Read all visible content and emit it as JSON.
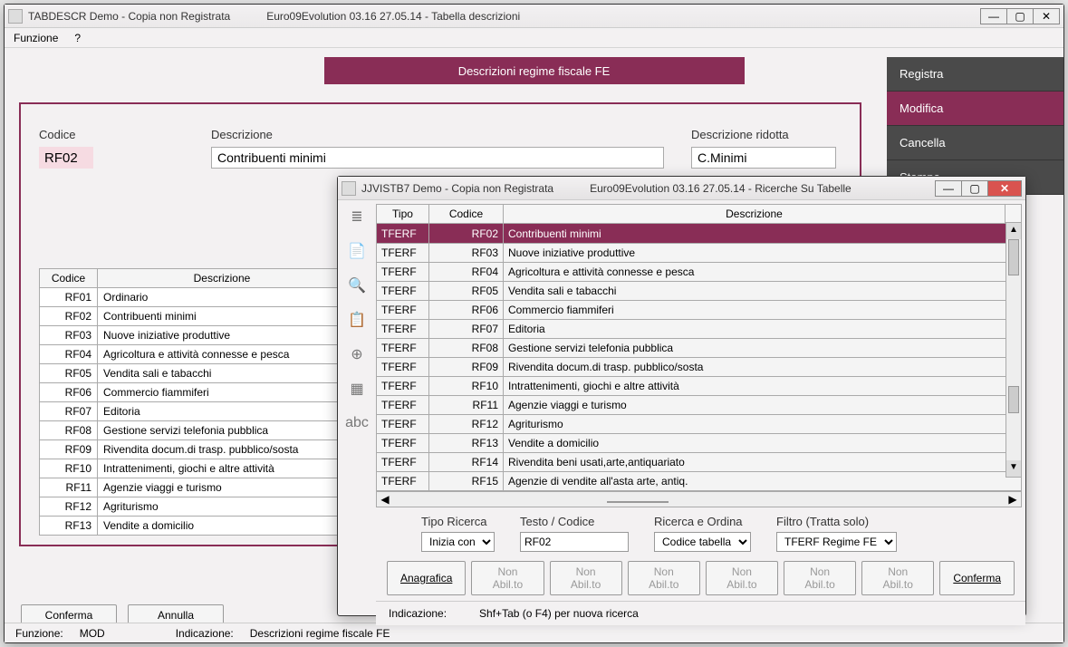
{
  "mainWin": {
    "titleA": "TABDESCR Demo - Copia non Registrata",
    "titleB": "Euro09Evolution 03.16 27.05.14 -  Tabella descrizioni",
    "menu": {
      "funzione": "Funzione",
      "help": "?"
    },
    "banner": "Descrizioni regime fiscale FE",
    "actions": {
      "registra": "Registra",
      "modifica": "Modifica",
      "cancella": "Cancella",
      "stampa": "Stampa"
    },
    "form": {
      "lbl_codice": "Codice",
      "val_codice": "RF02",
      "lbl_descr": "Descrizione",
      "val_descr": "Contribuenti minimi",
      "lbl_rid": "Descrizione ridotta",
      "val_rid": "C.Minimi"
    },
    "table": {
      "h1": "Codice",
      "h2": "Descrizione",
      "rows": [
        {
          "c": "RF01",
          "d": "Ordinario"
        },
        {
          "c": "RF02",
          "d": "Contribuenti minimi"
        },
        {
          "c": "RF03",
          "d": "Nuove iniziative produttive"
        },
        {
          "c": "RF04",
          "d": "Agricoltura e attività connesse e pesca"
        },
        {
          "c": "RF05",
          "d": "Vendita sali e tabacchi"
        },
        {
          "c": "RF06",
          "d": "Commercio fiammiferi"
        },
        {
          "c": "RF07",
          "d": "Editoria"
        },
        {
          "c": "RF08",
          "d": "Gestione servizi telefonia pubblica"
        },
        {
          "c": "RF09",
          "d": "Rivendita docum.di trasp. pubblico/sosta"
        },
        {
          "c": "RF10",
          "d": "Intrattenimenti, giochi e altre attività"
        },
        {
          "c": "RF11",
          "d": "Agenzie viaggi e turismo"
        },
        {
          "c": "RF12",
          "d": "Agriturismo"
        },
        {
          "c": "RF13",
          "d": "Vendite a domicilio"
        }
      ]
    },
    "buttons": {
      "conferma": "Conferma",
      "annulla": "Annulla"
    },
    "status": {
      "funz_lbl": "Funzione:",
      "funz": "MOD",
      "ind_lbl": "Indicazione:",
      "ind": "Descrizioni regime fiscale FE"
    }
  },
  "lookupWin": {
    "titleA": "JJVISTB7 Demo - Copia non Registrata",
    "titleB": "Euro09Evolution 03.16 27.05.14 - Ricerche Su Tabelle",
    "icons": [
      "≣",
      "📄",
      "🔍",
      "📋",
      "⊕",
      "▦",
      "abc"
    ],
    "headers": {
      "tipo": "Tipo",
      "codice": "Codice",
      "descr": "Descrizione"
    },
    "rows": [
      {
        "t": "TFERF",
        "c": "RF02",
        "d": "Contribuenti minimi"
      },
      {
        "t": "TFERF",
        "c": "RF03",
        "d": "Nuove iniziative produttive"
      },
      {
        "t": "TFERF",
        "c": "RF04",
        "d": "Agricoltura e attività connesse e pesca"
      },
      {
        "t": "TFERF",
        "c": "RF05",
        "d": "Vendita sali e tabacchi"
      },
      {
        "t": "TFERF",
        "c": "RF06",
        "d": "Commercio fiammiferi"
      },
      {
        "t": "TFERF",
        "c": "RF07",
        "d": "Editoria"
      },
      {
        "t": "TFERF",
        "c": "RF08",
        "d": "Gestione servizi telefonia pubblica"
      },
      {
        "t": "TFERF",
        "c": "RF09",
        "d": "Rivendita docum.di trasp. pubblico/sosta"
      },
      {
        "t": "TFERF",
        "c": "RF10",
        "d": "Intrattenimenti, giochi e altre attività"
      },
      {
        "t": "TFERF",
        "c": "RF11",
        "d": "Agenzie viaggi e turismo"
      },
      {
        "t": "TFERF",
        "c": "RF12",
        "d": "Agriturismo"
      },
      {
        "t": "TFERF",
        "c": "RF13",
        "d": "Vendite a domicilio"
      },
      {
        "t": "TFERF",
        "c": "RF14",
        "d": "Rivendita beni usati,arte,antiquariato"
      },
      {
        "t": "TFERF",
        "c": "RF15",
        "d": "Agenzie di vendite all'asta arte, antiq."
      }
    ],
    "search": {
      "tipo_lbl": "Tipo Ricerca",
      "tipo": "Inizia con",
      "testo_lbl": "Testo / Codice",
      "testo": "RF02",
      "ord_lbl": "Ricerca e Ordina",
      "ord": "Codice tabella",
      "filtro_lbl": "Filtro (Tratta solo)",
      "filtro": "TFERF Regime FE"
    },
    "btns": {
      "anag": "Anagrafica",
      "non": "Non Abil.to",
      "conf": "Conferma"
    },
    "hint": {
      "lbl": "Indicazione:",
      "txt": "Shf+Tab (o F4) per nuova ricerca"
    }
  }
}
